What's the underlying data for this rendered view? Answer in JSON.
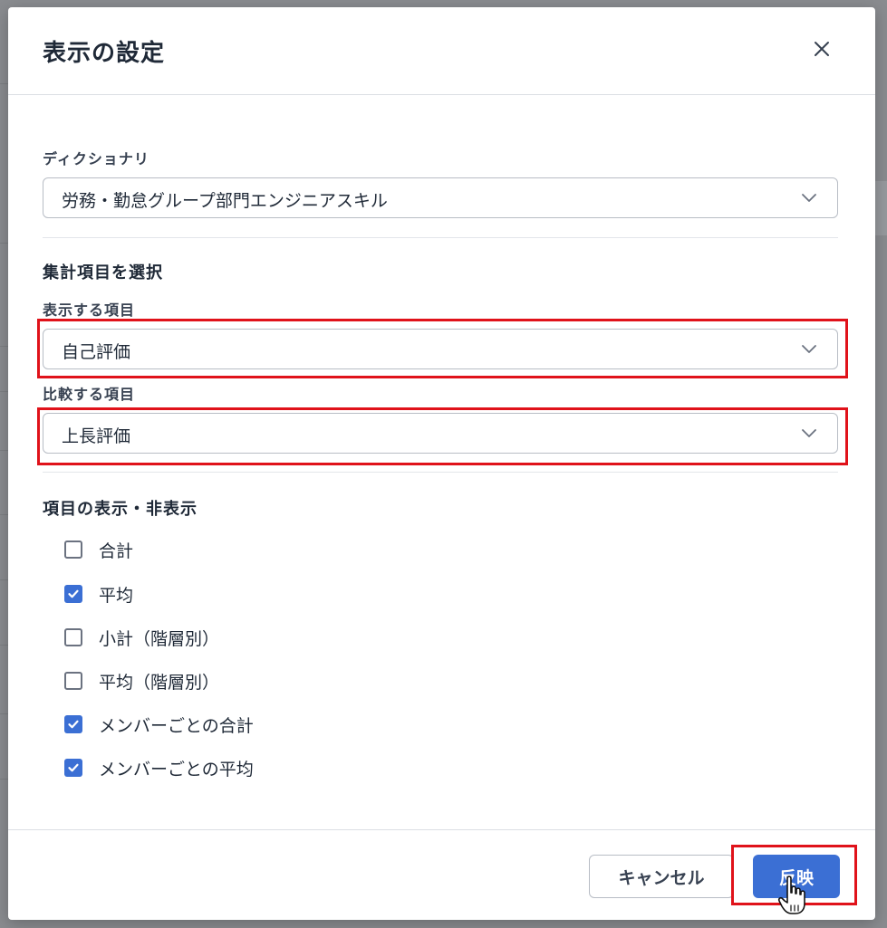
{
  "modal": {
    "title": "表示の設定",
    "close_icon": "close-icon"
  },
  "dictionary": {
    "label": "ディクショナリ",
    "value": "労務・勤怠グループ部門エンジニアスキル"
  },
  "aggregate": {
    "section_title": "集計項目を選択",
    "display_label": "表示する項目",
    "display_value": "自己評価",
    "compare_label": "比較する項目",
    "compare_value": "上長評価"
  },
  "visibility": {
    "section_title": "項目の表示・非表示",
    "items": [
      {
        "label": "合計",
        "checked": false
      },
      {
        "label": "平均",
        "checked": true
      },
      {
        "label": "小計（階層別）",
        "checked": false
      },
      {
        "label": "平均（階層別）",
        "checked": false
      },
      {
        "label": "メンバーごとの合計",
        "checked": true
      },
      {
        "label": "メンバーごとの平均",
        "checked": true
      }
    ]
  },
  "footer": {
    "cancel_label": "キャンセル",
    "apply_label": "反映"
  },
  "colors": {
    "accent": "#3b6fd4",
    "highlight": "#e0121a"
  }
}
